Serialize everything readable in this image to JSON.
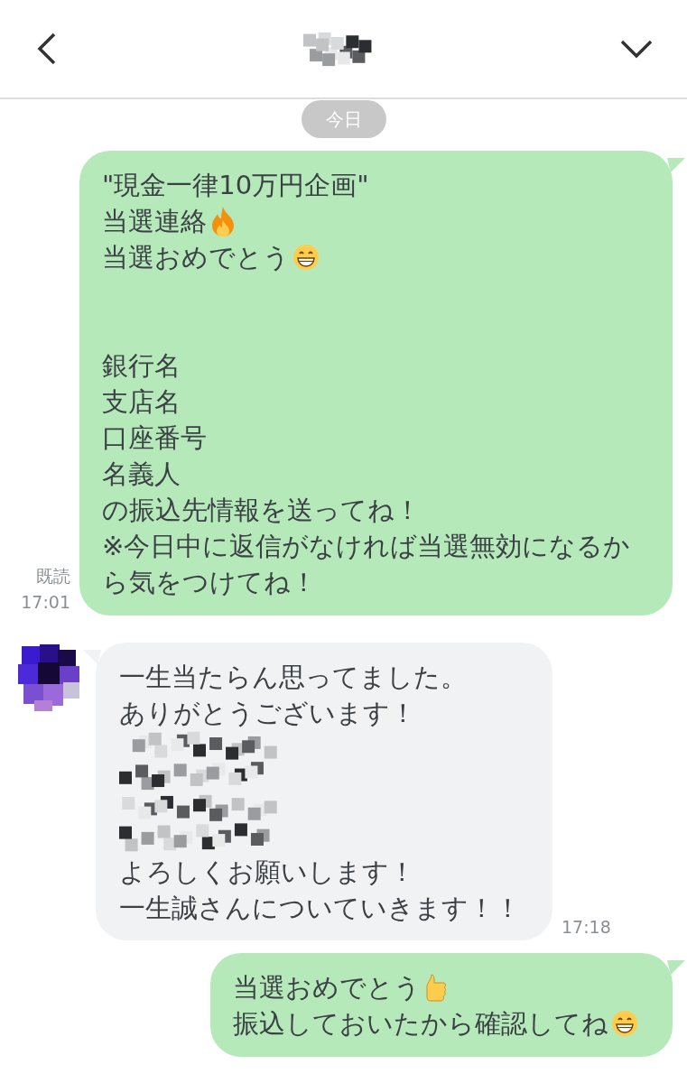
{
  "header": {
    "title": {
      "kind": "mosaic"
    }
  },
  "date_divider": "今日",
  "messages": [
    {
      "kind": "outgoing",
      "read_label": "既読",
      "time": "17:01",
      "lines": [
        {
          "kind": "text",
          "text": "\"現金一律10万円企画\""
        },
        {
          "kind": "text",
          "text": "当選連絡",
          "emoji": {
            "kind": "fire"
          }
        },
        {
          "kind": "text",
          "text": "当選おめでとう",
          "emoji": {
            "kind": "grin"
          }
        },
        {
          "kind": "blank"
        },
        {
          "kind": "blank"
        },
        {
          "kind": "text",
          "text": "銀行名"
        },
        {
          "kind": "text",
          "text": "支店名"
        },
        {
          "kind": "text",
          "text": "口座番号"
        },
        {
          "kind": "text",
          "text": "名義人"
        },
        {
          "kind": "text",
          "text": "の振込先情報を送ってね！"
        },
        {
          "kind": "text",
          "text": "※今日中に返信がなければ当選無効になるから気をつけてね！"
        }
      ]
    },
    {
      "kind": "incoming",
      "avatar": {
        "kind": "mosaic"
      },
      "time": "17:18",
      "lines": [
        {
          "kind": "text",
          "text": "一生当たらん思ってました。"
        },
        {
          "kind": "text",
          "text": "ありがとうございます！"
        },
        {
          "kind": "mosaic"
        },
        {
          "kind": "mosaic"
        },
        {
          "kind": "mosaic"
        },
        {
          "kind": "mosaic"
        },
        {
          "kind": "text",
          "text": "よろしくお願いします！"
        },
        {
          "kind": "text",
          "text": "一生誠さんについていきます！！"
        }
      ]
    },
    {
      "kind": "outgoing",
      "lines": [
        {
          "kind": "text",
          "text": "当選おめでとう",
          "emoji": {
            "kind": "thumbs"
          }
        },
        {
          "kind": "text",
          "text": "振込しておいたから確認してね",
          "emoji": {
            "kind": "grin"
          }
        }
      ]
    }
  ]
}
